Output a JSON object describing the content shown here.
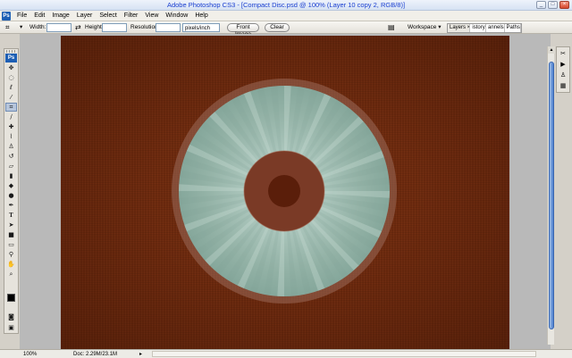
{
  "window": {
    "title": "Adobe Photoshop CS3 - [Compact Disc.psd @ 100% (Layer 10 copy 2, RGB/8)]"
  },
  "app_badge": "Ps",
  "menu": [
    "File",
    "Edit",
    "Image",
    "Layer",
    "Select",
    "Filter",
    "View",
    "Window",
    "Help"
  ],
  "options_bar": {
    "width_label": "Width:",
    "height_label": "Height:",
    "resolution_label": "Resolution:",
    "resolution_unit": "pixels/inch",
    "front_image_label": "Front Image",
    "clear_label": "Clear",
    "workspace_label": "Workspace ▾"
  },
  "panel_tabs": [
    "Layers ×",
    "istory",
    "annels",
    "Paths"
  ],
  "status": {
    "zoom": "100%",
    "doc": "Doc: 2.29M/23.1M"
  },
  "colors": {
    "background_fill": "#6e2a0e",
    "disc": "#98b5aa",
    "disc_ring": "#9a6a5a"
  },
  "icons": {
    "tools": [
      "move-icon",
      "marquee-icon",
      "lasso-icon",
      "magic-wand-icon",
      "crop-icon",
      "slice-icon",
      "healing-brush-icon",
      "brush-icon",
      "clone-stamp-icon",
      "history-brush-icon",
      "eraser-icon",
      "gradient-icon",
      "blur-icon",
      "dodge-icon",
      "pen-icon",
      "type-icon",
      "path-selection-icon",
      "rectangle-icon",
      "notes-icon",
      "eyedropper-icon",
      "hand-icon",
      "zoom-icon"
    ]
  }
}
